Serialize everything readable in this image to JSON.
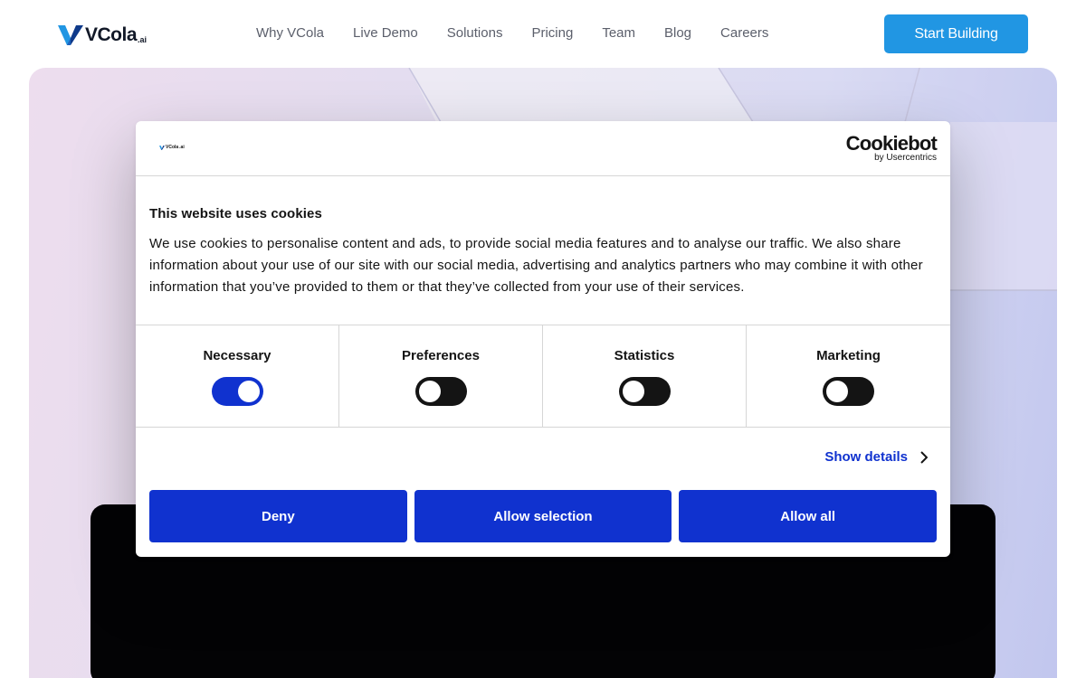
{
  "header": {
    "logo_text": "VCola",
    "logo_suffix": ".ai",
    "nav": [
      "Why VCola",
      "Live Demo",
      "Solutions",
      "Pricing",
      "Team",
      "Blog",
      "Careers"
    ],
    "cta_label": "Start Building",
    "cta_color": "#2196e3"
  },
  "dialog": {
    "mini_logo_text": "VCola",
    "mini_logo_suffix": ".ai",
    "brand_name": "Cookiebot",
    "brand_sub": "by Usercentrics",
    "title": "This website uses cookies",
    "body": "We use cookies to personalise content and ads, to provide social media features and to analyse our traffic. We also share information about your use of our site with our social media, advertising and analytics partners who may combine it with other information that you’ve provided to them or that they’ve collected from your use of their services.",
    "toggles": [
      {
        "label": "Necessary",
        "on": true
      },
      {
        "label": "Preferences",
        "on": false
      },
      {
        "label": "Statistics",
        "on": false
      },
      {
        "label": "Marketing",
        "on": false
      }
    ],
    "show_details": "Show details",
    "buttons": {
      "deny": "Deny",
      "allow_selection": "Allow selection",
      "allow_all": "Allow all"
    },
    "accent_color": "#1032cf"
  }
}
